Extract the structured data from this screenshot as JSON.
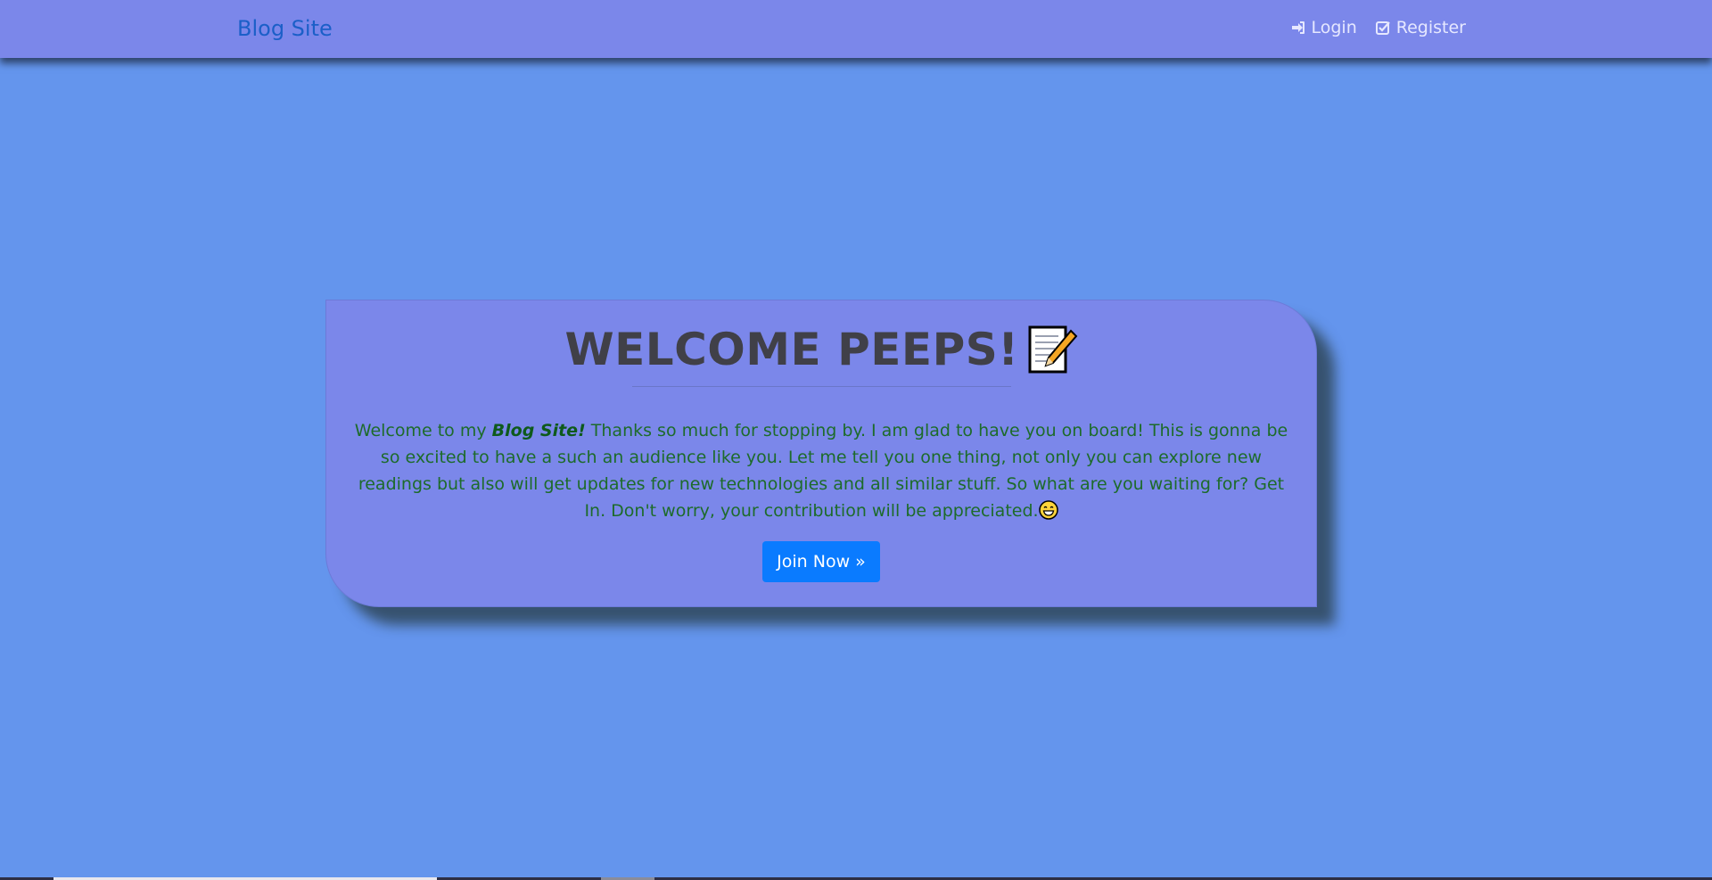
{
  "navbar": {
    "brand": "Blog Site",
    "links": [
      {
        "label": "Login",
        "icon": "sign-in-icon"
      },
      {
        "label": "Register",
        "icon": "check-square-icon"
      }
    ]
  },
  "hero": {
    "title": "WELCOME PEEPS!",
    "title_icon": "memo-icon",
    "intro_prefix": "Welcome to my ",
    "intro_emphasis": "Blog Site!",
    "intro_body": " Thanks so much for stopping by. I am glad to have you on board! This is gonna be so excited to have a such an audience like you. Let me tell you one thing, not only you can explore new readings but also will get updates for new technologies and all similar stuff. So what are you waiting for? Get In. Don't worry, your contribution will be appreciated.",
    "intro_icon": "grinning-face-icon",
    "button_label": "Join Now »"
  },
  "colors": {
    "background": "#6495ed",
    "navbar": "#7b87ea",
    "brand": "#1b5fc8",
    "text_green": "#1d6b2a",
    "button": "#0a7bff"
  }
}
